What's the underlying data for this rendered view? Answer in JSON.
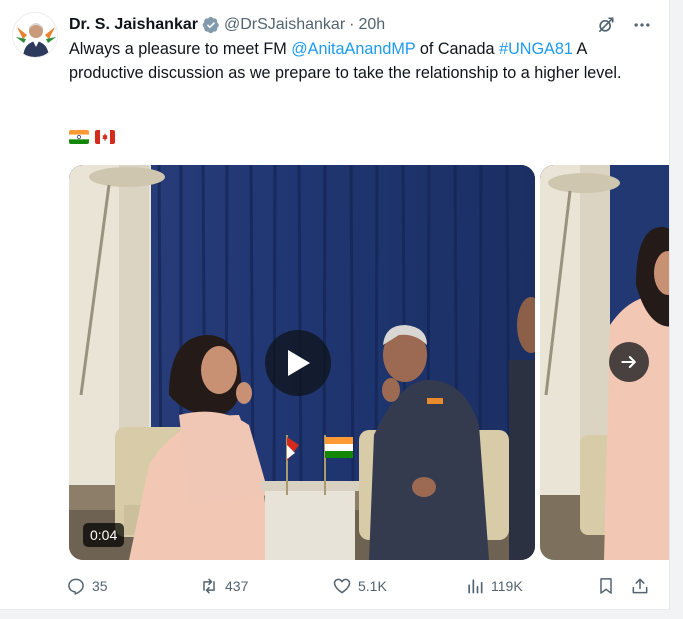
{
  "tweet": {
    "display_name": "Dr. S. Jaishankar",
    "handle": "@DrSJaishankar",
    "separator": "·",
    "time": "20h",
    "text_part1": "Always a pleasure to meet FM ",
    "mention": "@AnitaAnandMP",
    "text_part2": " of Canada ",
    "hashtag": "#UNGA81",
    "text_part3": " A productive discussion as we prepare to take the relationship to a higher level.",
    "flags": [
      "india-flag",
      "canada-flag"
    ]
  },
  "media": {
    "duration": "0:04"
  },
  "actions": {
    "replies": "35",
    "reposts": "437",
    "likes": "5.1K",
    "views": "119K"
  },
  "colors": {
    "link": "#1d9bf0",
    "text": "#0f1419",
    "muted": "#536471"
  }
}
